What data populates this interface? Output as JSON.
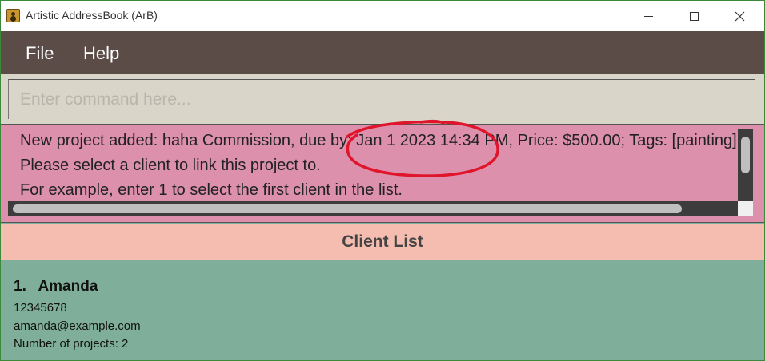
{
  "window": {
    "title": "Artistic AddressBook (ArB)",
    "accent_border": "#3a8a3a"
  },
  "menu": {
    "items": [
      "File",
      "Help"
    ],
    "background": "#5b4c48"
  },
  "command": {
    "placeholder": "Enter command here...",
    "value": ""
  },
  "result": {
    "lines": [
      "New project added: haha Commission, due by: Jan 1 2023 14:34 PM, Price: $500.00; Tags: [painting]",
      "Please select a client to link this project to.",
      "For example, enter 1 to select the first client in the list."
    ],
    "background": "#dc90ab",
    "annotation_color": "#e0142a"
  },
  "client_list": {
    "header": "Client List",
    "header_background": "#f5bcb0",
    "card_background": "#7faf9a",
    "clients": [
      {
        "index": "1.",
        "name": "Amanda",
        "phone": "12345678",
        "email": "amanda@example.com",
        "projects": "Number of projects: 2"
      }
    ]
  },
  "icons": [
    "app-icon",
    "minimize-icon",
    "maximize-icon",
    "close-icon"
  ]
}
